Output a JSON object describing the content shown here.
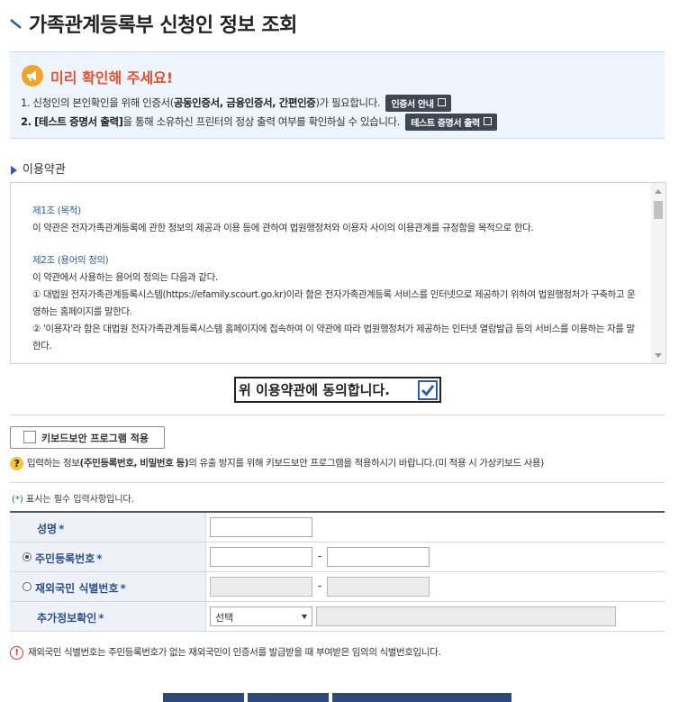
{
  "page": {
    "title": "가족관계등록부 신청인 정보 조회"
  },
  "notice": {
    "heading": "미리 확인해 주세요!",
    "line1": {
      "prefix": "1. 신청인의 본인확인을 위해 인증서(",
      "bold": "공동인증서, 금융인증서, 간편인증",
      "suffix": ")가 필요합니다.",
      "button": "인증서 안내"
    },
    "line2": {
      "bold": "2. [테스트 증명서 출력]",
      "suffix": "을 통해 소유하신 프린터의 정상 출력 여부를 확인하실 수 있습니다.",
      "button": "테스트 증명서 출력"
    }
  },
  "terms": {
    "heading": "이용약관",
    "article1_title": "제1조 (목적)",
    "article1_body": "이 약관은 전자가족관계등록에 관한 정보의 제공과 이용 등에 관하여 법원행정처와 이용자 사이의 이용관계를 규정함을 목적으로 한다.",
    "article2_title": "제2조 (용어의 정의)",
    "article2_intro": "이 약관에서 사용하는 용어의 정의는 다음과 같다.",
    "article2_item1": "① 대법원 전자가족관계등록시스템(https://efamily.scourt.go.kr)이라 함은 전자가족관계등록 서비스를 인터넷으로 제공하기 위하여 법원행정처가 구축하고 운영하는 홈페이지를 말한다.",
    "article2_item2": "② '이용자'라 함은 대법원 전자가족관계등록시스템 홈페이지에 접속하여 이 약관에 따라 법원행정처가 제공하는 인터넷 열람발급 등의 서비스를 이용하는 자를 말한다.",
    "agree_label": "위 이용약관에 동의합니다."
  },
  "keyboard": {
    "button_label": "키보드보안 프로그램 적용",
    "help_prefix": "입력하는 정보",
    "help_bold": "(주민등록번호, 비밀번호 등)",
    "help_suffix": "의 유출 방지를 위해 키보드보안 프로그램을 적용하시기 바랍니다.(미 적용 시 가상키보드 사용)"
  },
  "form": {
    "required_note_star": "(*)",
    "required_note": " 표시는 필수 입력사항입니다.",
    "name_label": "성명",
    "resident_label": "주민등록번호",
    "foreigner_label": "재외국민 식별번호",
    "extra_label": "추가정보확인",
    "star": "*",
    "dash": "-",
    "select_value": "선택"
  },
  "warning": {
    "text": "재외국민 식별번호는 주민등록번호가 없는 재외국민이 인증서를 발급받을 때 부여받은 임의의 식별번호입니다."
  },
  "icons": {
    "title_mark": "diagonal-mark-icon",
    "notice": "megaphone-icon",
    "help": "question-icon",
    "warning": "exclamation-icon"
  },
  "colors": {
    "accent": "#2a5ea8",
    "notice_heading": "#e8502f",
    "notice_bg": "#eef4fb",
    "button_dark": "#3f4752",
    "form_head_bg": "#eef2f8"
  }
}
